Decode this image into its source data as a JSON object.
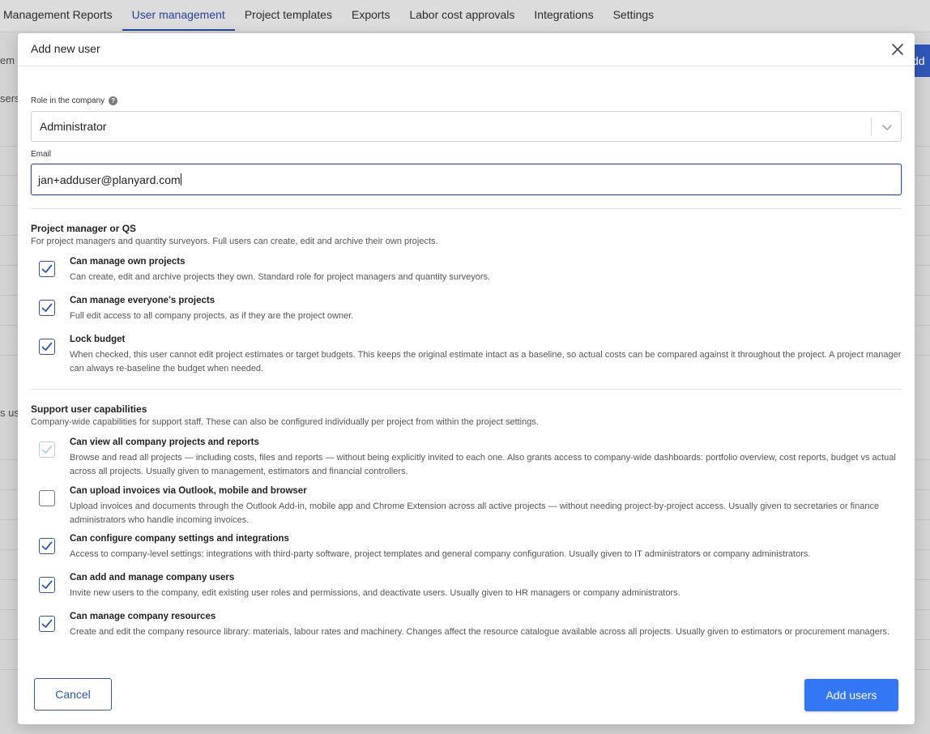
{
  "nav": {
    "tabs": [
      {
        "label": "Management Reports",
        "active": false
      },
      {
        "label": "User management",
        "active": true
      },
      {
        "label": "Project templates",
        "active": false
      },
      {
        "label": "Exports",
        "active": false
      },
      {
        "label": "Labor cost approvals",
        "active": false
      },
      {
        "label": "Integrations",
        "active": false
      },
      {
        "label": "Settings",
        "active": false
      }
    ]
  },
  "background": {
    "frag_left_1": "em",
    "frag_left_2": "sers",
    "frag_left_3": "s us",
    "frag_right_btn": "dd"
  },
  "modal": {
    "title": "Add new user",
    "role_label": "Role in the company",
    "role_value": "Administrator",
    "email_label": "Email",
    "email_value": "jan+adduser@planyard.com",
    "sections": [
      {
        "title": "Project manager or QS",
        "description": "For project managers and quantity surveyors. Full users can create, edit and archive their own projects.",
        "permissions": [
          {
            "title": "Can manage own projects",
            "description": "Can create, edit and archive projects they own. Standard role for project managers and quantity surveyors.",
            "state": "checked"
          },
          {
            "title": "Can manage everyone's projects",
            "description": "Full edit access to all company projects, as if they are the project owner.",
            "state": "checked"
          },
          {
            "title": "Lock budget",
            "description": "When checked, this user cannot edit project estimates or target budgets. This keeps the original estimate intact as a baseline, so actual costs can be compared against it throughout the project. A project manager can always re-baseline the budget when needed.",
            "state": "checked"
          }
        ]
      },
      {
        "title": "Support user capabilities",
        "description": "Company-wide capabilities for support staff. These can also be configured individually per project from within the project settings.",
        "permissions": [
          {
            "title": "Can view all company projects and reports",
            "description": "Browse and read all projects — including costs, files and reports — without being explicitly invited to each one. Also grants access to company-wide dashboards: portfolio overview, cost reports, budget vs actual across all projects. Usually given to management, estimators and financial controllers.",
            "state": "disabled"
          },
          {
            "title": "Can upload invoices via Outlook, mobile and browser",
            "description": "Upload invoices and documents through the Outlook Add-in, mobile app and Chrome Extension across all active projects — without needing project-by-project access. Usually given to secretaries or finance administrators who handle incoming invoices.",
            "state": "unchecked"
          },
          {
            "title": "Can configure company settings and integrations",
            "description": "Access to company-level settings: integrations with third-party software, project templates and general company configuration. Usually given to IT administrators or company administrators.",
            "state": "checked"
          },
          {
            "title": "Can add and manage company users",
            "description": "Invite new users to the company, edit existing user roles and permissions, and deactivate users. Usually given to HR managers or company administrators.",
            "state": "checked"
          },
          {
            "title": "Can manage company resources",
            "description": "Create and edit the company resource library: materials, labour rates and machinery. Changes affect the resource catalogue available across all projects. Usually given to estimators or procurement managers.",
            "state": "checked"
          }
        ]
      }
    ],
    "cancel_label": "Cancel",
    "submit_label": "Add users"
  },
  "colors": {
    "accent": "#3477f5",
    "checkbox_border": "#2d55b8",
    "active_tab": "#24449a"
  }
}
